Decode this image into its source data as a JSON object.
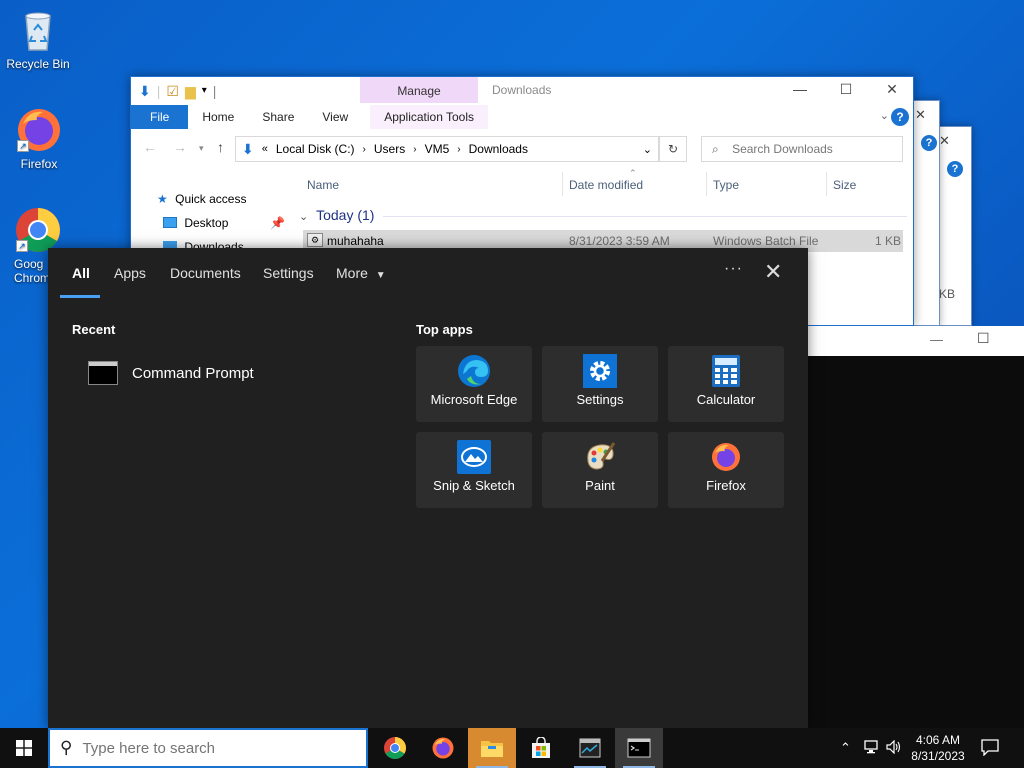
{
  "desktop": {
    "icons": [
      {
        "label": "Recycle Bin"
      },
      {
        "label": "Firefox"
      },
      {
        "label": "Goog\nChrom"
      }
    ]
  },
  "explorer": {
    "title": "Downloads",
    "manage_label": "Manage",
    "ribbon_tabs": [
      "File",
      "Home",
      "Share",
      "View",
      "Application Tools"
    ],
    "breadcrumb": [
      "Local Disk (C:)",
      "Users",
      "VM5",
      "Downloads"
    ],
    "search_placeholder": "Search Downloads",
    "nav": {
      "quick_access": "Quick access",
      "desktop": "Desktop",
      "downloads": "Downloads"
    },
    "columns": [
      "Name",
      "Date modified",
      "Type",
      "Size"
    ],
    "group": "Today (1)",
    "file": {
      "name": "muhahaha",
      "date": "8/31/2023 3:59 AM",
      "type": "Windows Batch File",
      "size": "1 KB"
    },
    "bg_window_fragment": "KB"
  },
  "search_panel": {
    "tabs": [
      "All",
      "Apps",
      "Documents",
      "Settings",
      "More"
    ],
    "recent_heading": "Recent",
    "recent_items": [
      {
        "label": "Command Prompt",
        "icon": "command-prompt-icon"
      }
    ],
    "top_apps_heading": "Top apps",
    "top_apps": [
      {
        "label": "Microsoft Edge",
        "icon": "edge-icon"
      },
      {
        "label": "Settings",
        "icon": "settings-gear-icon"
      },
      {
        "label": "Calculator",
        "icon": "calculator-icon"
      },
      {
        "label": "Snip & Sketch",
        "icon": "snip-sketch-icon"
      },
      {
        "label": "Paint",
        "icon": "paint-icon"
      },
      {
        "label": "Firefox",
        "icon": "firefox-icon"
      }
    ]
  },
  "taskbar": {
    "search_placeholder": "Type here to search",
    "apps": [
      "Google Chrome",
      "Firefox",
      "File Explorer",
      "Microsoft Store",
      "Task Manager",
      "Command Prompt"
    ],
    "time": "4:06 AM",
    "date": "8/31/2023"
  },
  "colors": {
    "desktop_bg": "#0b6fd9",
    "panel_bg": "#202020",
    "tile_bg": "#2d2d2d",
    "accent": "#1a73d0",
    "taskbar_bg": "#101010"
  }
}
